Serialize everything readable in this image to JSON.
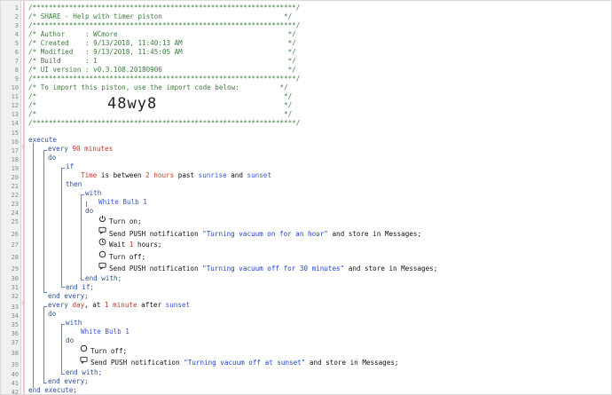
{
  "lines": [
    {
      "n": "1",
      "t": "/*****************************************************************/",
      "cls": "cm",
      "x": 31
    },
    {
      "n": "2",
      "t": "/* SHARE - Help with timer piston                              */",
      "cls": "cm",
      "x": 31
    },
    {
      "n": "3",
      "t": "/*****************************************************************/",
      "cls": "cm",
      "x": 31
    },
    {
      "n": "4",
      "t": "/* Author     : WCmore                                          */",
      "cls": "cm",
      "x": 31
    },
    {
      "n": "5",
      "t": "/* Created    : 9/13/2018, 11:40:13 AM                          */",
      "cls": "cm",
      "x": 31
    },
    {
      "n": "6",
      "t": "/* Modified   : 9/13/2018, 11:45:05 AM                          */",
      "cls": "cm",
      "x": 31
    },
    {
      "n": "7",
      "t": "/* Build      : 1                                               */",
      "cls": "cm",
      "x": 31
    },
    {
      "n": "8",
      "t": "/* UI version : v0.3.108.20180906                               */",
      "cls": "cm",
      "x": 31
    },
    {
      "n": "9",
      "t": "/*****************************************************************/",
      "cls": "cm",
      "x": 31
    },
    {
      "n": "10",
      "t": "/* To import this piston, use the import code below:          */",
      "cls": "cm",
      "x": 31
    },
    {
      "n": "11",
      "t": "/*                                                             */",
      "cls": "cm",
      "x": 31
    },
    {
      "n": "12",
      "t": "/*                                                             */",
      "cls": "cm",
      "x": 31
    },
    {
      "n": "13",
      "t": "/*                                                             */",
      "cls": "cm",
      "x": 31
    },
    {
      "n": "14",
      "t": "/*****************************************************************/",
      "cls": "cm",
      "x": 31
    }
  ],
  "import_code": "48wy8",
  "code": {
    "l16": "execute",
    "l17a": "every ",
    "l17b": "90",
    "l17c": " minutes",
    "l18": "do",
    "l19": "if",
    "l20a": "Time",
    "l20b": " is between ",
    "l20c": "2",
    "l20d": " hours",
    "l20e": " past ",
    "l20f": "sunrise",
    "l20g": " and ",
    "l20h": "sunset",
    "l21": "then",
    "l22": "with",
    "l23": "White Bulb 1",
    "l24": "do",
    "l25": "Turn on;",
    "l26a": "Send PUSH notification ",
    "l26b": "\"Turning vacuum on for an hour\"",
    "l26c": " and store in Messages;",
    "l27a": "Wait ",
    "l27b": "1",
    "l27c": " hours;",
    "l28": "Turn off;",
    "l29a": "Send PUSH notification ",
    "l29b": "\"Turning vacuum off for 30 minutes\"",
    "l29c": " and store in Messages;",
    "l30": "end with;",
    "l31": "end if;",
    "l32": "end every;",
    "l33a": "every ",
    "l33b": "day",
    "l33c": ", at ",
    "l33d": "1",
    "l33e": " minute",
    "l33f": " after ",
    "l33g": "sunset",
    "l34": "do",
    "l35": "with",
    "l36": "White Bulb 1",
    "l37": "do",
    "l38": "Turn off;",
    "l39a": "Send PUSH notification ",
    "l39b": "\"Turning vacuum off at sunset\"",
    "l39c": " and store in Messages;",
    "l40": "end with;",
    "l41": "end every;",
    "l42": "end execute;"
  },
  "line_numbers": [
    "1",
    "2",
    "3",
    "4",
    "5",
    "6",
    "7",
    "8",
    "9",
    "10",
    "11",
    "12",
    "13",
    "14",
    "15",
    "16",
    "17",
    "18",
    "19",
    "20",
    "21",
    "22",
    "23",
    "24",
    "25",
    "26",
    "27",
    "28",
    "29",
    "30",
    "31",
    "32",
    "33",
    "34",
    "35",
    "36",
    "37",
    "38",
    "39",
    "40",
    "41",
    "42"
  ],
  "icons": {
    "power": "power-icon",
    "message": "message-icon",
    "clock": "clock-icon",
    "power_off": "power-off-icon"
  }
}
